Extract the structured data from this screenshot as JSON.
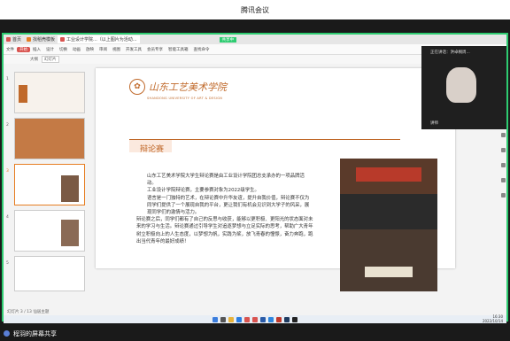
{
  "meeting_title": "腾讯会议",
  "browser_tabs": [
    {
      "label": "首页",
      "color": "#d9534f"
    },
    {
      "label": "找稻壳模板",
      "color": "#e67e22"
    },
    {
      "label": "工业设计学院...（以上图片为活动...",
      "color": "#d9534f"
    }
  ],
  "share_badge": "共享中",
  "ribbon": [
    "文件",
    "开始",
    "插入",
    "设计",
    "切换",
    "动画",
    "放映",
    "审阅",
    "视图",
    "开发工具",
    "会员专享",
    "智能工具箱",
    "查找命令"
  ],
  "ribbon_selected": "开始",
  "subtabs": [
    "大纲",
    "幻灯片"
  ],
  "subtab_selected": "幻灯片",
  "thumb_numbers": [
    "1",
    "2",
    "3",
    "4",
    "5"
  ],
  "slide": {
    "logo_cn": "山东工艺美术学院",
    "logo_en": "SHANDONG UNIVERSITY OF ART & DESIGN",
    "title": "辩论赛",
    "paragraphs": [
      "山东工艺美术学院大学生辩论赛是由工业设计学院团总支承办的一项品牌活动。",
      "工业设计学院辩论赛，主要参赛对象为2022级学生。",
      "语言是一门独特的艺术，在辩论赛中升华友谊，提升自我价值，辩论赛不仅为同学们提供了一个展现自我的平台，更让我们有机会见识到大学子的风采，展现同学们的激情与活力。",
      "辩论赛之后，同学们都有了自己的反思与收获，能够以更积极、更阳光的状态面对未来的学习与生活。辩论赛通过引导学生对追逐梦想与立足实际的思考，帮助广大青年树立积极向上的人生态度，以梦想为帆，实践为桨，放飞青春的憧憬，奋力奔跑，跑出当代青年的最好成绩！"
    ]
  },
  "statusbar": "幻灯片 3 / 13    仙居主题",
  "video": {
    "top_label": "正在讲话：洪卓桐周...",
    "bottom_label": "讲师"
  },
  "clock": {
    "time": "16:30",
    "date": "2022/10/14"
  },
  "footer_text": "程羽的屏幕共享",
  "colors": {
    "accent": "#c0692a",
    "share_border": "#2ecc71",
    "ribbon_red": "#d9534f"
  }
}
